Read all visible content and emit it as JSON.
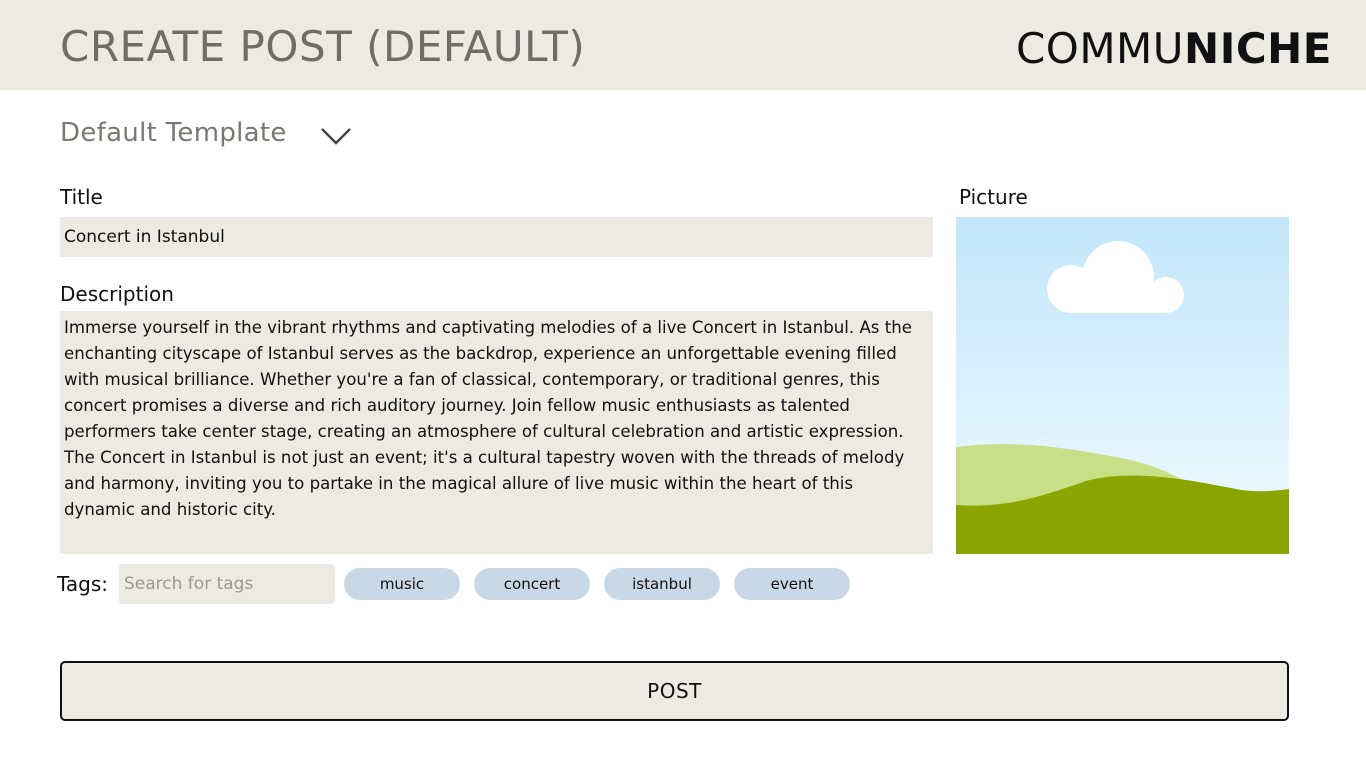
{
  "header": {
    "title": "CREATE POST (DEFAULT)",
    "brand_light": "COMMU",
    "brand_bold": "NICHE"
  },
  "template": {
    "selected": "Default Template",
    "icon": "chevron-down-icon"
  },
  "form": {
    "title_label": "Title",
    "title_value": "Concert in Istanbul",
    "description_label": "Description",
    "description_value": "Immerse yourself in the vibrant rhythms and captivating melodies of a live Concert in Istanbul. As the enchanting cityscape of Istanbul serves as the backdrop, experience an unforgettable evening filled with musical brilliance. Whether you're a fan of classical, contemporary, or traditional genres, this concert promises a diverse and rich auditory journey. Join fellow music enthusiasts as talented performers take center stage, creating an atmosphere of cultural celebration and artistic expression. The Concert in Istanbul is not just an event; it's a cultural tapestry woven with the threads of melody and harmony, inviting you to partake in the magical allure of live music within the heart of this dynamic and historic city.",
    "picture_label": "Picture",
    "tags_label": "Tags:",
    "tags_placeholder": "Search for tags",
    "tags": [
      "music",
      "concert",
      "istanbul",
      "event"
    ]
  },
  "actions": {
    "post_label": "POST"
  },
  "colors": {
    "header_bg": "#edeae4",
    "field_bg": "#edeae4",
    "tag_bg": "#c9d8e6",
    "title_gray": "#6f6d68"
  }
}
